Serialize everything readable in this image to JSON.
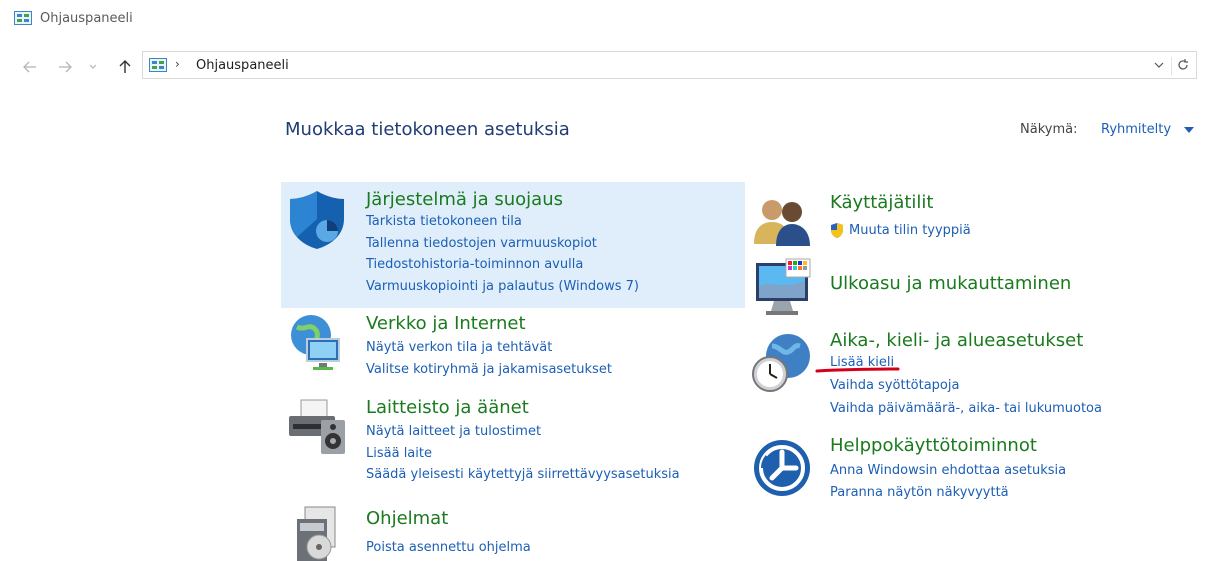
{
  "window": {
    "title": "Ohjauspaneeli"
  },
  "address_bar": {
    "breadcrumb": "Ohjauspaneeli"
  },
  "header": {
    "heading": "Muokkaa tietokoneen asetuksia",
    "view_label": "Näkymä:",
    "view_value": "Ryhmitelty"
  },
  "categories": {
    "system": {
      "title": "Järjestelmä ja suojaus",
      "links": [
        "Tarkista tietokoneen tila",
        "Tallenna tiedostojen varmuuskopiot",
        "Tiedostohistoria-toiminnon avulla",
        "Varmuuskopiointi ja palautus (Windows 7)"
      ]
    },
    "network": {
      "title": "Verkko ja Internet",
      "links": [
        "Näytä verkon tila ja tehtävät",
        "Valitse kotiryhmä ja jakamisasetukset"
      ]
    },
    "hardware": {
      "title": "Laitteisto ja äänet",
      "links": [
        "Näytä laitteet ja tulostimet",
        "Lisää laite",
        "Säädä yleisesti käytettyjä siirrettävyysasetuksia"
      ]
    },
    "programs": {
      "title": "Ohjelmat",
      "links": [
        "Poista asennettu ohjelma"
      ]
    },
    "users": {
      "title": "Käyttäjätilit",
      "links": [
        "Muuta tilin tyyppiä"
      ]
    },
    "appearance": {
      "title": "Ulkoasu ja mukauttaminen",
      "links": []
    },
    "clock": {
      "title": "Aika-, kieli- ja alueasetukset",
      "links": [
        "Lisää kieli",
        "Vaihda syöttötapoja",
        "Vaihda päivämäärä-, aika- tai lukumuotoa"
      ]
    },
    "ease": {
      "title": "Helppokäyttötoiminnot",
      "links": [
        "Anna Windowsin ehdottaa asetuksia",
        "Paranna näytön näkyvyyttä"
      ]
    }
  },
  "colors": {
    "link": "#1c5fb5",
    "category_title": "#1a7a1e",
    "heading": "#1f3c74",
    "highlight": "#dfeefa",
    "annotation": "#d4001a"
  }
}
